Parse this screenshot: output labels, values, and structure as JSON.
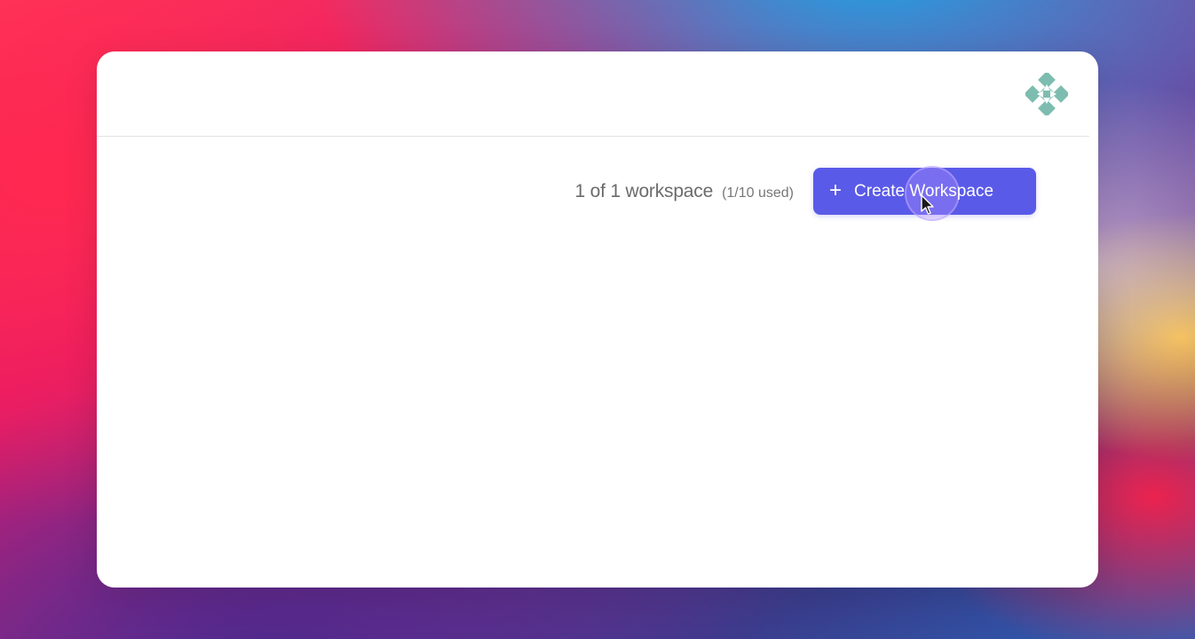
{
  "window": {
    "logo_icon": "teal-geometric-logo-icon"
  },
  "workspaces": {
    "count_text": "1 of 1 workspace",
    "usage_text": "(1/10 used)",
    "create_button_label": "Create Workspace",
    "create_button_icon": "plus-icon"
  },
  "colors": {
    "accent": "#5a5ae8",
    "logo": "#7dbdb0"
  }
}
